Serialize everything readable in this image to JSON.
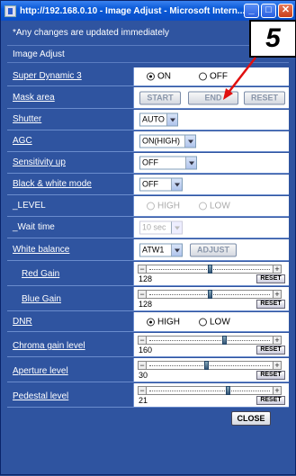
{
  "window": {
    "title": "http://192.168.0.10 - Image Adjust - Microsoft Intern...",
    "min_glyph": "_",
    "max_glyph": "□",
    "close_glyph": "✕"
  },
  "notice": "*Any changes are updated immediately",
  "section_title": "Image Adjust",
  "callout_number": "5",
  "rows": {
    "super_dynamic": {
      "label": "Super Dynamic 3",
      "on": "ON",
      "off": "OFF",
      "selected": "ON"
    },
    "mask_area": {
      "label": "Mask area",
      "start": "START",
      "end": "END",
      "reset": "RESET"
    },
    "shutter": {
      "label": "Shutter",
      "value": "AUTO"
    },
    "agc": {
      "label": "AGC",
      "value": "ON(HIGH)"
    },
    "sensitivity": {
      "label": "Sensitivity up",
      "value": "OFF"
    },
    "bw_mode": {
      "label": "Black & white mode",
      "value": "OFF"
    },
    "level": {
      "label": "_LEVEL",
      "high": "HIGH",
      "low": "LOW"
    },
    "wait_time": {
      "label": "_Wait time",
      "value": "10 sec"
    },
    "white_balance": {
      "label": "White balance",
      "value": "ATW1",
      "adjust": "ADJUST"
    },
    "red_gain": {
      "label": "Red Gain",
      "value": "128",
      "level": 0.5,
      "reset": "RESET"
    },
    "blue_gain": {
      "label": "Blue Gain",
      "value": "128",
      "level": 0.5,
      "reset": "RESET"
    },
    "dnr": {
      "label": "DNR",
      "high": "HIGH",
      "low": "LOW",
      "selected": "HIGH"
    },
    "chroma": {
      "label": "Chroma gain level",
      "value": "160",
      "level": 0.63,
      "reset": "RESET"
    },
    "aperture": {
      "label": "Aperture level",
      "value": "30",
      "level": 0.47,
      "reset": "RESET"
    },
    "pedestal": {
      "label": "Pedestal level",
      "value": "21",
      "level": 0.66,
      "reset": "RESET"
    }
  },
  "close_button": "CLOSE"
}
